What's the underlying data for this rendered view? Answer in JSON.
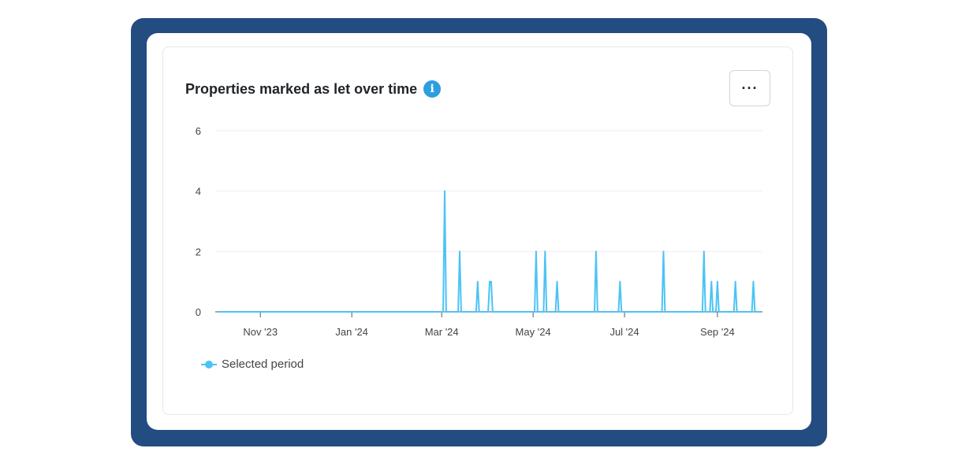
{
  "card": {
    "title": "Properties marked as let over time",
    "info_icon": "info-icon",
    "more_label": "···",
    "more_icon": "more-horizontal-icon"
  },
  "colors": {
    "frame": "#234c80",
    "series": "#4cc3f5",
    "info": "#2d9fe0"
  },
  "chart_data": {
    "type": "line",
    "title": "Properties marked as let over time",
    "xlabel": "",
    "ylabel": "",
    "ylim": [
      0,
      6
    ],
    "y_ticks": [
      "0",
      "2",
      "4",
      "6"
    ],
    "x_ticks": [
      "Nov '23",
      "Jan '24",
      "Mar '24",
      "May '24",
      "Jul '24",
      "Sep '24"
    ],
    "x_tick_dates": [
      "2023-11-01",
      "2024-01-01",
      "2024-03-01",
      "2024-05-01",
      "2024-07-01",
      "2024-09-01"
    ],
    "x_range": [
      "2023-10-04",
      "2024-09-30"
    ],
    "grid": true,
    "legend_position": "bottom-left",
    "series": [
      {
        "name": "Selected period",
        "points": [
          {
            "x": "2023-10-04",
            "y": 0
          },
          {
            "x": "2024-03-03",
            "y": 4
          },
          {
            "x": "2024-03-13",
            "y": 2
          },
          {
            "x": "2024-03-25",
            "y": 1
          },
          {
            "x": "2024-04-02",
            "y": 1
          },
          {
            "x": "2024-04-03",
            "y": 1
          },
          {
            "x": "2024-05-03",
            "y": 2
          },
          {
            "x": "2024-05-09",
            "y": 2
          },
          {
            "x": "2024-05-17",
            "y": 1
          },
          {
            "x": "2024-06-12",
            "y": 2
          },
          {
            "x": "2024-06-28",
            "y": 1
          },
          {
            "x": "2024-07-27",
            "y": 2
          },
          {
            "x": "2024-08-23",
            "y": 2
          },
          {
            "x": "2024-08-28",
            "y": 1
          },
          {
            "x": "2024-09-01",
            "y": 1
          },
          {
            "x": "2024-09-13",
            "y": 1
          },
          {
            "x": "2024-09-25",
            "y": 1
          },
          {
            "x": "2024-09-30",
            "y": 0
          }
        ]
      }
    ]
  }
}
